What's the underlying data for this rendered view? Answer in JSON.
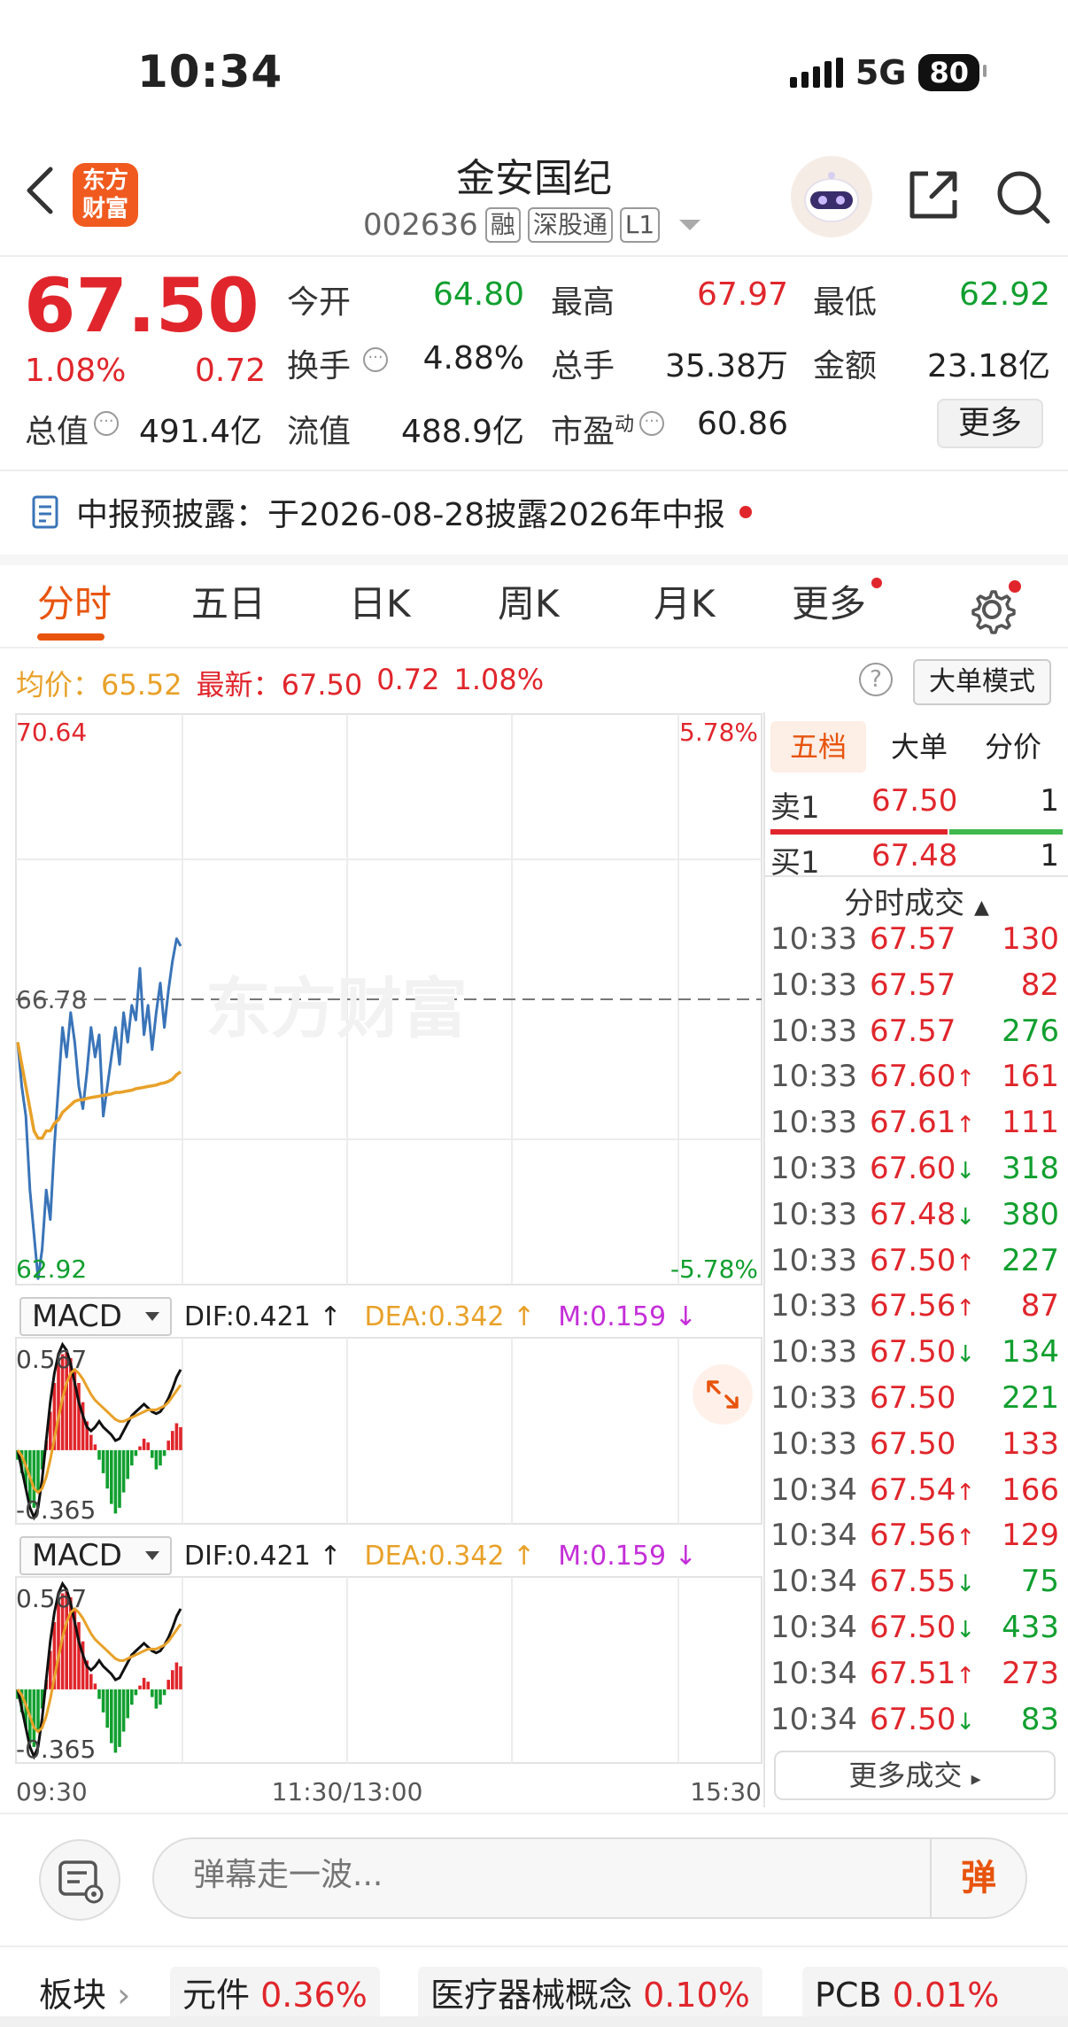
{
  "status_bar": {
    "time": "10:34",
    "network": "5G",
    "battery": "80"
  },
  "header": {
    "logo_text": "东方财富",
    "title": "金安国纪",
    "code": "002636",
    "tags": [
      "融",
      "深股通",
      "L1"
    ]
  },
  "quote": {
    "price": "67.50",
    "change_pct": "1.08%",
    "change_amt": "0.72",
    "fields": [
      {
        "label": "今开",
        "value": "64.80",
        "color": "#119f2f"
      },
      {
        "label": "最高",
        "value": "67.97",
        "color": "#e0262c"
      },
      {
        "label": "最低",
        "value": "62.92",
        "color": "#119f2f"
      },
      {
        "label": "换手",
        "value": "4.88%",
        "color": "#222222"
      },
      {
        "label": "总手",
        "value": "35.38万",
        "color": "#222222"
      },
      {
        "label": "金额",
        "value": "23.18亿",
        "color": "#222222"
      }
    ],
    "total_cap_label": "总值",
    "total_cap": "491.4亿",
    "float_cap_label": "流值",
    "float_cap": "488.9亿",
    "pe_label": "市盈",
    "pe_sup": "动",
    "pe": "60.86",
    "more_label": "更多"
  },
  "notice": {
    "text": "中报预披露：于2026-08-28披露2026年中报"
  },
  "tabs": [
    "分时",
    "五日",
    "日K",
    "周K",
    "月K",
    "更多"
  ],
  "avg_row": {
    "avg_label": "均价：",
    "avg_value": "65.52",
    "latest_label": "最新：",
    "latest_value": "67.50",
    "change_amt": "0.72",
    "change_pct": "1.08%",
    "big_order_label": "大单模式"
  },
  "chart": {
    "y_high": "70.64",
    "y_mid": "66.78",
    "y_low": "62.92",
    "pct_high": "5.78%",
    "pct_low": "-5.78%",
    "watermark": "东方财富",
    "x_labels": [
      "09:30",
      "11:30/13:00",
      "15:30"
    ]
  },
  "chart_data": {
    "type": "line",
    "ylim": [
      62.92,
      70.64
    ],
    "prev_close": 66.78,
    "series": [
      {
        "values": [
          66.2,
          65.6,
          65.2,
          64.2,
          63.6,
          63.0,
          63.4,
          64.2,
          63.8,
          64.8,
          65.6,
          66.4,
          66.0,
          66.6,
          66.2,
          65.6,
          65.3,
          65.8,
          66.4,
          66.0,
          66.3,
          65.2,
          65.6,
          66.0,
          66.4,
          65.9,
          66.6,
          66.2,
          66.7,
          66.5,
          67.2,
          66.3,
          66.7,
          66.1,
          66.6,
          67.0,
          66.4,
          66.9,
          67.3,
          67.6,
          67.5
        ]
      },
      {
        "values": [
          66.2,
          65.9,
          65.6,
          65.3,
          65.0,
          64.9,
          64.9,
          65.0,
          65.0,
          65.1,
          65.15,
          65.25,
          65.3,
          65.35,
          65.4,
          65.42,
          65.42,
          65.44,
          65.45,
          65.46,
          65.47,
          65.48,
          65.49,
          65.5,
          65.52,
          65.52,
          65.53,
          65.54,
          65.55,
          65.57,
          65.58,
          65.59,
          65.6,
          65.61,
          65.62,
          65.64,
          65.65,
          65.67,
          65.7,
          65.76,
          65.8
        ]
      }
    ]
  },
  "macd": [
    {
      "label": "MACD",
      "dif": "DIF:0.421 ↑",
      "dea": "DEA:0.342 ↑",
      "m": "M:0.159 ↓",
      "top": "0.567",
      "bottom": "-0.365"
    },
    {
      "label": "MACD",
      "dif": "DIF:0.421 ↑",
      "dea": "DEA:0.342 ↑",
      "m": "M:0.159 ↓",
      "top": "0.567",
      "bottom": "-0.365"
    }
  ],
  "macd_data": {
    "bars": [
      -0.05,
      -0.12,
      -0.2,
      -0.28,
      -0.3,
      -0.22,
      -0.1,
      0.05,
      0.2,
      0.35,
      0.45,
      0.5,
      0.52,
      0.48,
      0.42,
      0.35,
      0.25,
      0.15,
      0.08,
      0.03,
      -0.05,
      -0.12,
      -0.2,
      -0.28,
      -0.33,
      -0.3,
      -0.22,
      -0.15,
      -0.08,
      -0.03,
      0.02,
      0.06,
      0.04,
      -0.04,
      -0.1,
      -0.08,
      -0.03,
      0.05,
      0.1,
      0.14,
      0.12
    ],
    "dif": [
      0.0,
      -0.1,
      -0.2,
      -0.3,
      -0.35,
      -0.3,
      -0.15,
      0.05,
      0.25,
      0.4,
      0.5,
      0.55,
      0.52,
      0.45,
      0.35,
      0.25,
      0.18,
      0.12,
      0.1,
      0.12,
      0.15,
      0.12,
      0.1,
      0.08,
      0.05,
      0.06,
      0.1,
      0.14,
      0.18,
      0.2,
      0.22,
      0.24,
      0.22,
      0.2,
      0.19,
      0.2,
      0.23,
      0.27,
      0.32,
      0.38,
      0.42
    ],
    "dea": [
      0.0,
      -0.03,
      -0.08,
      -0.14,
      -0.2,
      -0.22,
      -0.2,
      -0.14,
      -0.05,
      0.06,
      0.17,
      0.27,
      0.35,
      0.4,
      0.42,
      0.4,
      0.37,
      0.33,
      0.29,
      0.26,
      0.24,
      0.22,
      0.2,
      0.18,
      0.16,
      0.15,
      0.15,
      0.16,
      0.17,
      0.18,
      0.19,
      0.2,
      0.21,
      0.21,
      0.21,
      0.22,
      0.23,
      0.25,
      0.28,
      0.31,
      0.34
    ]
  },
  "order_book": {
    "tabs": [
      "五档",
      "大单",
      "分价"
    ],
    "sell": {
      "label": "卖1",
      "price": "67.50",
      "qty": "1"
    },
    "buy": {
      "label": "买1",
      "price": "67.48",
      "qty": "1"
    }
  },
  "trades": {
    "header": "分时成交",
    "more_label": "更多成交",
    "rows": [
      {
        "time": "10:33",
        "price": "67.57",
        "arrow": "",
        "qty": "130",
        "qcolor": "#e0262c"
      },
      {
        "time": "10:33",
        "price": "67.57",
        "arrow": "",
        "qty": "82",
        "qcolor": "#e0262c"
      },
      {
        "time": "10:33",
        "price": "67.57",
        "arrow": "",
        "qty": "276",
        "qcolor": "#119f2f"
      },
      {
        "time": "10:33",
        "price": "67.60",
        "arrow": "↑",
        "qty": "161",
        "qcolor": "#e0262c"
      },
      {
        "time": "10:33",
        "price": "67.61",
        "arrow": "↑",
        "qty": "111",
        "qcolor": "#e0262c"
      },
      {
        "time": "10:33",
        "price": "67.60",
        "arrow": "↓",
        "qty": "318",
        "qcolor": "#119f2f"
      },
      {
        "time": "10:33",
        "price": "67.48",
        "arrow": "↓",
        "qty": "380",
        "qcolor": "#119f2f"
      },
      {
        "time": "10:33",
        "price": "67.50",
        "arrow": "↑",
        "qty": "227",
        "qcolor": "#119f2f"
      },
      {
        "time": "10:33",
        "price": "67.56",
        "arrow": "↑",
        "qty": "87",
        "qcolor": "#e0262c"
      },
      {
        "time": "10:33",
        "price": "67.50",
        "arrow": "↓",
        "qty": "134",
        "qcolor": "#119f2f"
      },
      {
        "time": "10:33",
        "price": "67.50",
        "arrow": "",
        "qty": "221",
        "qcolor": "#119f2f"
      },
      {
        "time": "10:33",
        "price": "67.50",
        "arrow": "",
        "qty": "133",
        "qcolor": "#e0262c"
      },
      {
        "time": "10:34",
        "price": "67.54",
        "arrow": "↑",
        "qty": "166",
        "qcolor": "#e0262c"
      },
      {
        "time": "10:34",
        "price": "67.56",
        "arrow": "↑",
        "qty": "129",
        "qcolor": "#e0262c"
      },
      {
        "time": "10:34",
        "price": "67.55",
        "arrow": "↓",
        "qty": "75",
        "qcolor": "#119f2f"
      },
      {
        "time": "10:34",
        "price": "67.50",
        "arrow": "↓",
        "qty": "433",
        "qcolor": "#119f2f"
      },
      {
        "time": "10:34",
        "price": "67.51",
        "arrow": "↑",
        "qty": "273",
        "qcolor": "#e0262c"
      },
      {
        "time": "10:34",
        "price": "67.50",
        "arrow": "↓",
        "qty": "83",
        "qcolor": "#119f2f"
      }
    ]
  },
  "comment": {
    "placeholder": "弹幕走一波...",
    "danmu_label": "弹"
  },
  "sectors": {
    "label": "板块",
    "items": [
      {
        "name": "元件",
        "pct": "0.36%"
      },
      {
        "name": "医疗器械概念",
        "pct": "0.10%"
      },
      {
        "name": "PCB",
        "pct": "0.01%"
      }
    ]
  },
  "colors": {
    "up": "#e0262c",
    "down": "#119f2f",
    "price_line": "#3a74b8",
    "avg_line": "#e8a129",
    "accent": "#e8540d"
  }
}
